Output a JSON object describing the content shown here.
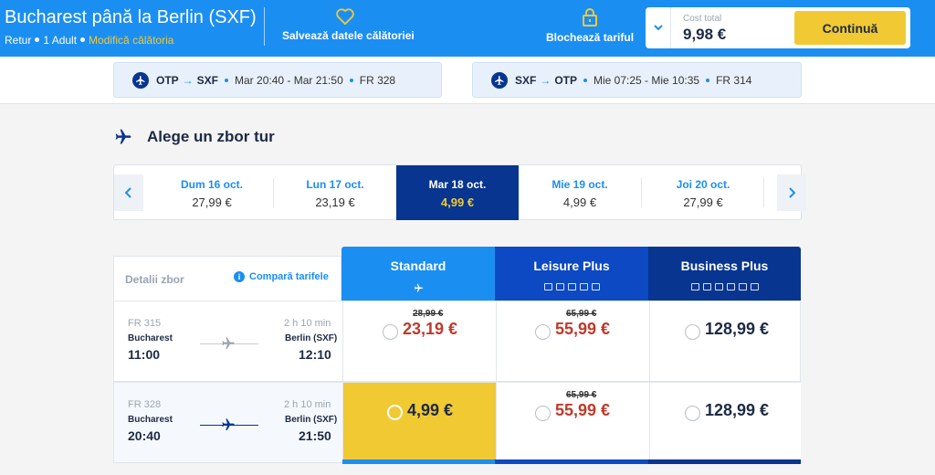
{
  "header": {
    "title": "Bucharest până la Berlin (SXF)",
    "trip_type": "Retur",
    "passengers": "1 Adult",
    "modify_link": "Modifică călătoria",
    "save_label": "Salvează datele călătoriei",
    "lock_label": "Blochează tariful",
    "cost_label": "Cost total",
    "cost_value": "9,98 €",
    "continue_label": "Continuă"
  },
  "flights": [
    {
      "from": "OTP",
      "to": "SXF",
      "times": "Mar 20:40 - Mar 21:50",
      "code": "FR 328"
    },
    {
      "from": "SXF",
      "to": "OTP",
      "times": "Mie 07:25 - Mie 10:35",
      "code": "FR 314"
    }
  ],
  "section_title": "Alege un zbor tur",
  "dates": [
    {
      "day": "Dum 16 oct.",
      "price": "27,99 €"
    },
    {
      "day": "Lun 17 oct.",
      "price": "23,19 €"
    },
    {
      "day": "Mar 18 oct.",
      "price": "4,99 €"
    },
    {
      "day": "Mie 19 oct.",
      "price": "4,99 €"
    },
    {
      "day": "Joi 20 oct.",
      "price": "27,99 €"
    }
  ],
  "table": {
    "details_label": "Detalii zbor",
    "compare_label": "Compară tarifele",
    "fares": [
      "Standard",
      "Leisure Plus",
      "Business Plus"
    ]
  },
  "rows": [
    {
      "code": "FR 315",
      "duration": "2 h 10 min",
      "from": "Bucharest",
      "to": "Berlin (SXF)",
      "dep": "11:00",
      "arr": "12:10",
      "standard_old": "28,99 €",
      "standard": "23,19 €",
      "leisure_old": "65,99 €",
      "leisure": "55,99 €",
      "business": "128,99 €"
    },
    {
      "code": "FR 328",
      "duration": "2 h 10 min",
      "from": "Bucharest",
      "to": "Berlin (SXF)",
      "dep": "20:40",
      "arr": "21:50",
      "standard": "4,99 €",
      "leisure_old": "65,99 €",
      "leisure": "55,99 €",
      "business": "128,99 €"
    }
  ],
  "colors": {
    "header_blue": "#1b8ef2",
    "navy": "#073590",
    "yellow": "#f1c933",
    "red_price": "#c0392b"
  }
}
